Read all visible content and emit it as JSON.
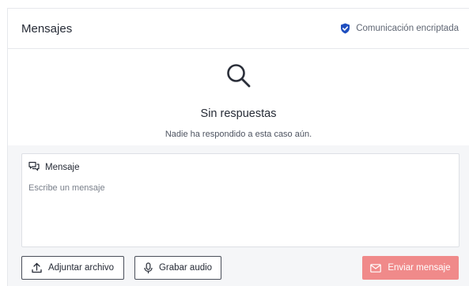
{
  "header": {
    "title": "Mensajes",
    "secure_label": "Comunicación encriptada",
    "secure_icon": "shield-check-icon",
    "secure_icon_color": "#1f4fbf"
  },
  "empty_state": {
    "icon": "search-icon",
    "title": "Sin respuestas",
    "subtitle": "Nadie ha respondido a esta caso aún."
  },
  "composer": {
    "label": "Mensaje",
    "label_icon": "chat-bubbles-icon",
    "placeholder": "Escribe un mensaje",
    "attach_label": "Adjuntar archivo",
    "attach_icon": "upload-icon",
    "audio_label": "Grabar audio",
    "audio_icon": "microphone-icon",
    "send_label": "Enviar mensaje",
    "send_icon": "mail-icon",
    "send_color": "#f08a8a"
  }
}
